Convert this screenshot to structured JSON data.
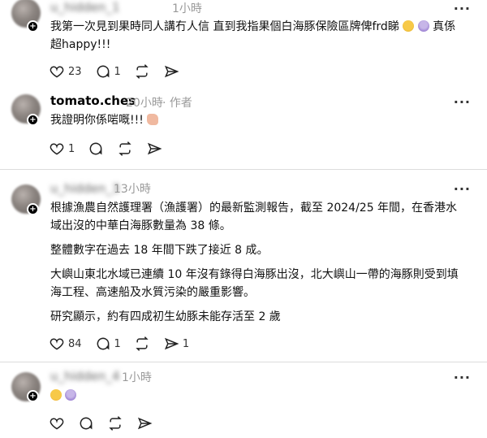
{
  "posts": [
    {
      "username": "u_hidden_1",
      "time": "1小時",
      "text_line1": "我第一次見到果時同人講冇人信 直到我指果個白海豚保險區牌俾frd睇",
      "text_line1_tail": "真係",
      "text_line2": "超happy!!!",
      "likes": "23",
      "comments": "1",
      "reposts": "",
      "shares": ""
    },
    {
      "username": "tomato.ches",
      "time": "20小時",
      "role": "· 作者",
      "text": "我證明你係啱嘅!!!",
      "likes": "1",
      "comments": "",
      "reposts": "",
      "shares": ""
    },
    {
      "username": "u_hidden_3",
      "time": "13小時",
      "paragraphs": [
        "根據漁農自然護理署（漁護署）的最新監測報告，截至 2024/25 年間，在香港水",
        "域出沒的中華白海豚數量為 38 條。",
        "整體數字在過去 18 年間下跌了接近 8 成。",
        "大嶼山東北水域已連續 10 年沒有錄得白海豚出沒，北大嶼山一帶的海豚則受到填",
        "海工程、高速船及水質污染的嚴重影響。",
        "研究顯示，約有四成初生幼豚未能存活至 2 歲"
      ],
      "likes": "84",
      "comments": "1",
      "reposts": "",
      "shares": "1"
    },
    {
      "username": "u_hidden_4",
      "time": "1小時",
      "likes": "",
      "comments": "",
      "reposts": "",
      "shares": ""
    }
  ],
  "icons": {
    "like": "heart-icon",
    "comment": "comment-icon",
    "repost": "repost-icon",
    "share": "send-icon",
    "more": "more-icon"
  },
  "more_glyph": "···"
}
